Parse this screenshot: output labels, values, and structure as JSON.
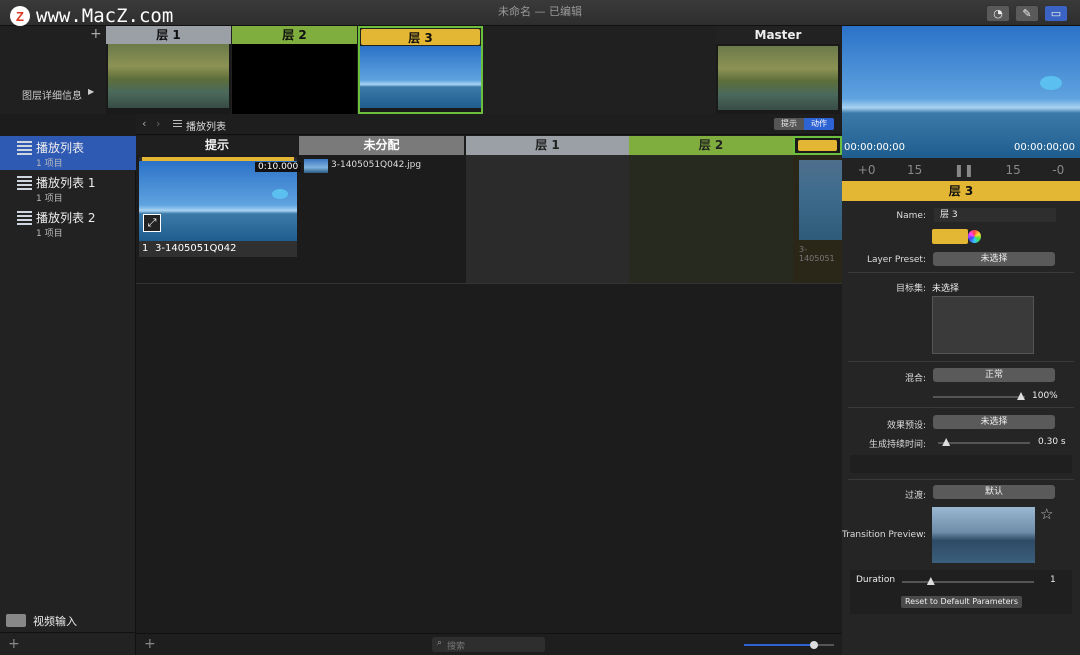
{
  "window": {
    "title": "未命名 — 已编辑"
  },
  "watermark": {
    "logo": "Z",
    "text": "www.MacZ.com"
  },
  "toolbar": {
    "icons": [
      "timer-icon",
      "pencil-icon",
      "screen-icon"
    ]
  },
  "layer_strip": {
    "add": "+",
    "details_label": "图层详细信息",
    "details_arrow": "▶",
    "layers": [
      {
        "name": "层 1",
        "color": "#9aa0a6"
      },
      {
        "name": "层 2",
        "color": "#7fae3e"
      },
      {
        "name": "层 3",
        "color": "#e3b733"
      }
    ],
    "master": "Master"
  },
  "preview": {
    "timecode_left": "00:00:00;00",
    "timecode_right": "00:00:00;00"
  },
  "transport": {
    "back_0": "+0",
    "back_15": "15",
    "pause": "❚❚",
    "fwd_15": "15",
    "fwd_0": "-0"
  },
  "sidebar": {
    "playlists": [
      {
        "name": "播放列表",
        "count": "1 项目",
        "selected": true
      },
      {
        "name": "播放列表 1",
        "count": "1 项目"
      },
      {
        "name": "播放列表 2",
        "count": "1 项目"
      }
    ],
    "video_input": "视频输入",
    "add": "+"
  },
  "crumb": {
    "path": "播放列表",
    "hint_tab": "提示",
    "action_tab": "动作"
  },
  "columns": [
    {
      "name": "提示",
      "color": "#e8e8e8"
    },
    {
      "name": "未分配",
      "color": "#7a7a7a"
    },
    {
      "name": "层 1",
      "color": "#9aa0a6"
    },
    {
      "name": "层 2",
      "color": "#7fae3e"
    }
  ],
  "cue": {
    "duration": "0:10.000",
    "index": "1",
    "name": "3-1405051Q042"
  },
  "unassigned": {
    "file": "3-1405051Q042.jpg"
  },
  "layer_overflow_label": "3-1405051",
  "bottom": {
    "add": "+",
    "search_placeholder": "搜索",
    "zoom": 0.8
  },
  "inspector": {
    "header": "层 3",
    "header_color": "#e3b733",
    "name_label": "Name:",
    "name_value": "层 3",
    "layer_preset_label": "Layer Preset:",
    "layer_preset_value": "未选择",
    "target_label": "目标集:",
    "target_value": "未选择",
    "blend_label": "混合:",
    "blend_value": "正常",
    "opacity": "100%",
    "opacity_level": 1.0,
    "effect_label": "效果预设:",
    "effect_value": "未选择",
    "gen_label": "生成持续时间:",
    "gen_value": "0.30 s",
    "gen_level": 0.05,
    "trans_label": "过渡:",
    "trans_value": "默认",
    "trans_preview_label": "Transition Preview:",
    "duration_label": "Duration",
    "duration_value": "1",
    "duration_level": 0.2,
    "reset": "Reset to Default Parameters"
  }
}
